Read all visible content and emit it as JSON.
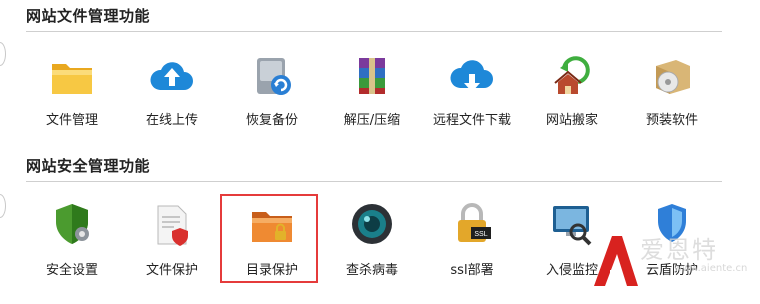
{
  "sections": [
    {
      "title": "网站文件管理功能",
      "items": [
        {
          "label": "文件管理"
        },
        {
          "label": "在线上传"
        },
        {
          "label": "恢复备份"
        },
        {
          "label": "解压/压缩"
        },
        {
          "label": "远程文件下载"
        },
        {
          "label": "网站搬家"
        },
        {
          "label": "预装软件"
        }
      ]
    },
    {
      "title": "网站安全管理功能",
      "items": [
        {
          "label": "安全设置"
        },
        {
          "label": "文件保护"
        },
        {
          "label": "目录保护"
        },
        {
          "label": "查杀病毒"
        },
        {
          "label": "ssl部署"
        },
        {
          "label": "入侵监控"
        },
        {
          "label": "云盾防护"
        }
      ]
    }
  ],
  "ssl_badge": "SSL",
  "watermark": {
    "text": "爱恩特",
    "url": "www.aiente.cn"
  },
  "colors": {
    "highlight_border": "#e53b3b",
    "divider": "#cfcfcf",
    "watermark_red": "#d8221f"
  }
}
